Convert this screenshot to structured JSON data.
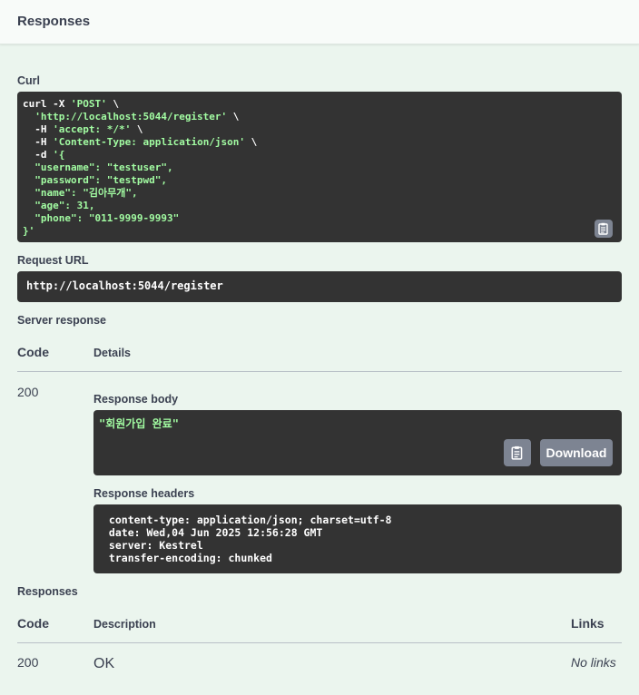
{
  "header": {
    "title": "Responses"
  },
  "curl": {
    "label": "Curl",
    "lines": [
      [
        {
          "t": "curl -X ",
          "c": "w"
        },
        {
          "t": "'POST'",
          "c": "g"
        },
        {
          "t": " \\",
          "c": "w"
        }
      ],
      [
        {
          "t": "  ",
          "c": "w"
        },
        {
          "t": "'http://localhost:5044/register'",
          "c": "g"
        },
        {
          "t": " \\",
          "c": "w"
        }
      ],
      [
        {
          "t": "  -H ",
          "c": "w"
        },
        {
          "t": "'accept: */*'",
          "c": "g"
        },
        {
          "t": " \\",
          "c": "w"
        }
      ],
      [
        {
          "t": "  -H ",
          "c": "w"
        },
        {
          "t": "'Content-Type: application/json'",
          "c": "g"
        },
        {
          "t": " \\",
          "c": "w"
        }
      ],
      [
        {
          "t": "  -d ",
          "c": "w"
        },
        {
          "t": "'{",
          "c": "g"
        }
      ],
      [
        {
          "t": "  \"username\": \"testuser\",",
          "c": "g"
        }
      ],
      [
        {
          "t": "  \"password\": \"testpwd\",",
          "c": "g"
        }
      ],
      [
        {
          "t": "  \"name\": \"김아무개\",",
          "c": "g"
        }
      ],
      [
        {
          "t": "  \"age\": 31,",
          "c": "g"
        }
      ],
      [
        {
          "t": "  \"phone\": \"011-9999-9993\"",
          "c": "g"
        }
      ],
      [
        {
          "t": "}'",
          "c": "g"
        }
      ]
    ],
    "copy_icon": "clipboard-icon"
  },
  "request_url": {
    "label": "Request URL",
    "value": "http://localhost:5044/register"
  },
  "server_response": {
    "label": "Server response",
    "col_code": "Code",
    "col_details": "Details",
    "code": "200",
    "body_label": "Response body",
    "body_value": "\"회원가입 완료\"",
    "download_label": "Download",
    "headers_label": "Response headers",
    "headers_text": " content-type: application/json; charset=utf-8 \n date: Wed,04 Jun 2025 12:56:28 GMT \n server: Kestrel \n transfer-encoding: chunked "
  },
  "responses": {
    "label": "Responses",
    "col_code": "Code",
    "col_description": "Description",
    "col_links": "Links",
    "code": "200",
    "description": "OK",
    "links": "No links"
  },
  "colors": {
    "background": "#ebf5ee",
    "code_bg": "#333333",
    "string_green": "#a2fca2",
    "button_gray": "#7d8492"
  }
}
